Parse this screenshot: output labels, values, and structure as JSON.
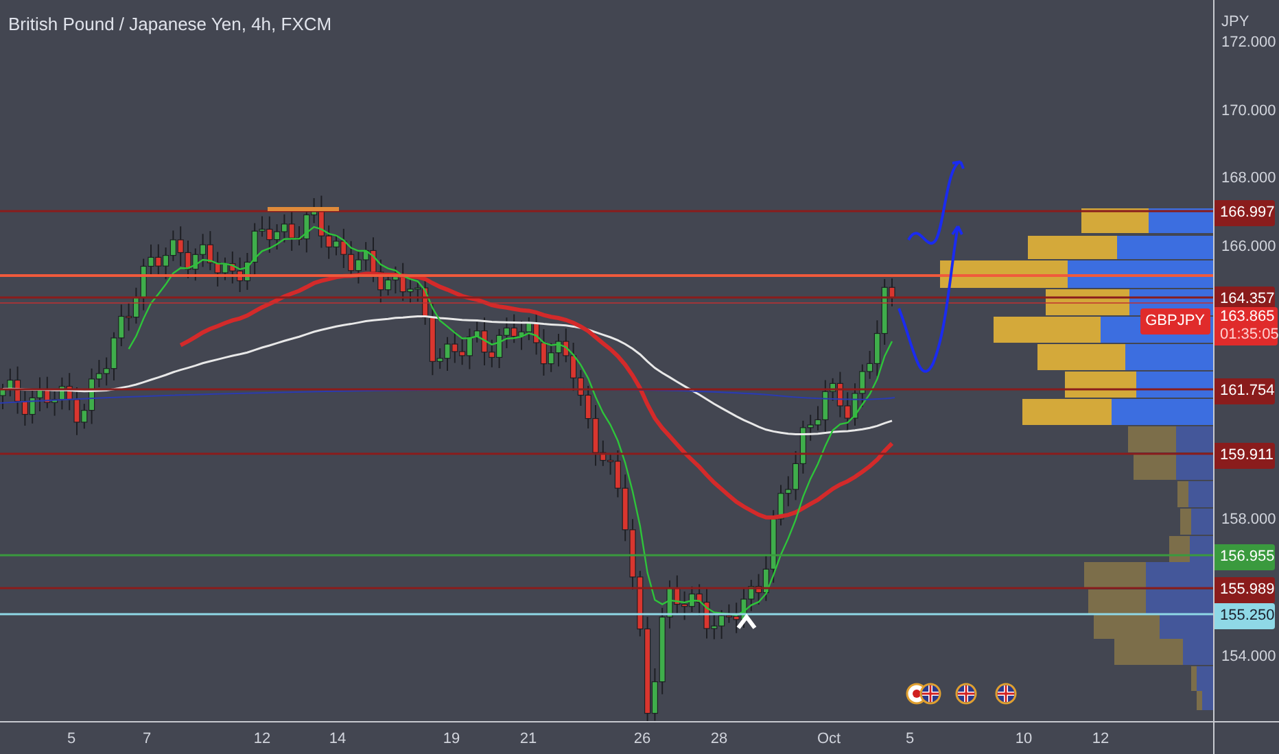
{
  "title": "British Pound / Japanese Yen, 4h, FXCM",
  "price_axis": {
    "currency": "JPY",
    "ticks": [
      "172.000",
      "170.000",
      "168.000",
      "166.000",
      "158.000",
      "154.000"
    ]
  },
  "levels": [
    {
      "price": "166.997",
      "color": "#8a1c1c"
    },
    {
      "price": "164.357",
      "color": "#8a1c1c"
    },
    {
      "price": "161.754",
      "color": "#8a1c1c"
    },
    {
      "price": "159.911",
      "color": "#8a1c1c"
    },
    {
      "price": "156.955",
      "color": "#3a9a3e"
    },
    {
      "price": "155.989",
      "color": "#8a1c1c"
    },
    {
      "price": "155.250",
      "color": "#8fd8e6"
    }
  ],
  "current": {
    "symbol": "GBPJPY",
    "price": "163.865",
    "countdown": "01:35:05"
  },
  "time_axis": [
    "5",
    "7",
    "12",
    "14",
    "19",
    "21",
    "26",
    "28",
    "Oct",
    "5",
    "10",
    "12"
  ]
}
